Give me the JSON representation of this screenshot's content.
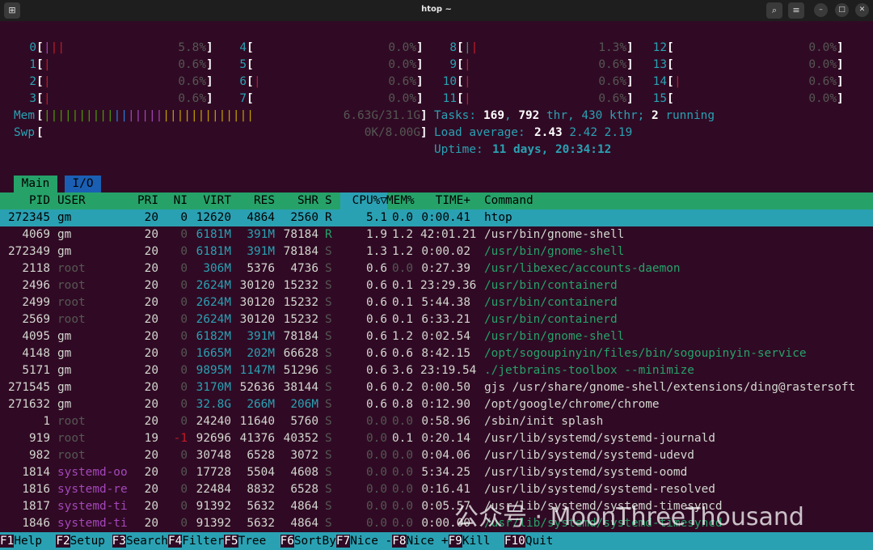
{
  "window": {
    "title": "htop ~"
  },
  "cpu_meters": [
    {
      "id": "0",
      "pct": "5.8%"
    },
    {
      "id": "1",
      "pct": "0.6%"
    },
    {
      "id": "2",
      "pct": "0.6%"
    },
    {
      "id": "3",
      "pct": "0.6%"
    },
    {
      "id": "4",
      "pct": "0.0%"
    },
    {
      "id": "5",
      "pct": "0.0%"
    },
    {
      "id": "6",
      "pct": "0.6%"
    },
    {
      "id": "7",
      "pct": "0.0%"
    },
    {
      "id": "8",
      "pct": "1.3%"
    },
    {
      "id": "9",
      "pct": "0.6%"
    },
    {
      "id": "10",
      "pct": "0.6%"
    },
    {
      "id": "11",
      "pct": "0.6%"
    },
    {
      "id": "12",
      "pct": "0.0%"
    },
    {
      "id": "13",
      "pct": "0.0%"
    },
    {
      "id": "14",
      "pct": "0.6%"
    },
    {
      "id": "15",
      "pct": "0.0%"
    }
  ],
  "mem": {
    "label": "Mem",
    "value": "6.63G/31.1G"
  },
  "swp": {
    "label": "Swp",
    "value": "0K/8.00G"
  },
  "tasks": {
    "label": "Tasks:",
    "tasks": "169",
    "thr": "792",
    "thr_label": "thr,",
    "kthr": "430",
    "kthr_label": "kthr;",
    "running": "2",
    "running_label": "running"
  },
  "load": {
    "label": "Load average:",
    "l1": "2.43",
    "l5": "2.42",
    "l15": "2.19"
  },
  "uptime": {
    "label": "Uptime:",
    "value": "11 days, 20:34:12"
  },
  "tabs": {
    "main": "Main",
    "io": "I/O"
  },
  "columns": {
    "pid": "PID",
    "user": "USER",
    "pri": "PRI",
    "ni": "NI",
    "virt": "VIRT",
    "res": "RES",
    "shr": "SHR",
    "s": "S",
    "cpu": "CPU%▽",
    "mem": "MEM%",
    "time": "TIME+",
    "command": "Command"
  },
  "processes": [
    {
      "pid": "272345",
      "user": "gm",
      "pri": "20",
      "ni": "0",
      "virt": "12620",
      "res": "4864",
      "shr": "2560",
      "s": "R",
      "cpu": "5.1",
      "mem": "0.0",
      "time": "0:00.41",
      "command": "htop"
    },
    {
      "pid": "4069",
      "user": "gm",
      "pri": "20",
      "ni": "0",
      "virt": "6181M",
      "res": "391M",
      "shr": "78184",
      "s": "R",
      "cpu": "1.9",
      "mem": "1.2",
      "time": "42:01.21",
      "command": "/usr/bin/gnome-shell"
    },
    {
      "pid": "272349",
      "user": "gm",
      "pri": "20",
      "ni": "0",
      "virt": "6181M",
      "res": "391M",
      "shr": "78184",
      "s": "S",
      "cpu": "1.3",
      "mem": "1.2",
      "time": "0:00.02",
      "command": "/usr/bin/gnome-shell"
    },
    {
      "pid": "2118",
      "user": "root",
      "pri": "20",
      "ni": "0",
      "virt": "306M",
      "res": "5376",
      "shr": "4736",
      "s": "S",
      "cpu": "0.6",
      "mem": "0.0",
      "time": "0:27.39",
      "command": "/usr/libexec/accounts-daemon"
    },
    {
      "pid": "2496",
      "user": "root",
      "pri": "20",
      "ni": "0",
      "virt": "2624M",
      "res": "30120",
      "shr": "15232",
      "s": "S",
      "cpu": "0.6",
      "mem": "0.1",
      "time": "23:29.36",
      "command": "/usr/bin/containerd"
    },
    {
      "pid": "2499",
      "user": "root",
      "pri": "20",
      "ni": "0",
      "virt": "2624M",
      "res": "30120",
      "shr": "15232",
      "s": "S",
      "cpu": "0.6",
      "mem": "0.1",
      "time": "5:44.38",
      "command": "/usr/bin/containerd"
    },
    {
      "pid": "2569",
      "user": "root",
      "pri": "20",
      "ni": "0",
      "virt": "2624M",
      "res": "30120",
      "shr": "15232",
      "s": "S",
      "cpu": "0.6",
      "mem": "0.1",
      "time": "6:33.21",
      "command": "/usr/bin/containerd"
    },
    {
      "pid": "4095",
      "user": "gm",
      "pri": "20",
      "ni": "0",
      "virt": "6182M",
      "res": "391M",
      "shr": "78184",
      "s": "S",
      "cpu": "0.6",
      "mem": "1.2",
      "time": "0:02.54",
      "command": "/usr/bin/gnome-shell"
    },
    {
      "pid": "4148",
      "user": "gm",
      "pri": "20",
      "ni": "0",
      "virt": "1665M",
      "res": "202M",
      "shr": "66628",
      "s": "S",
      "cpu": "0.6",
      "mem": "0.6",
      "time": "8:42.15",
      "command": "/opt/sogoupinyin/files/bin/sogoupinyin-service"
    },
    {
      "pid": "5171",
      "user": "gm",
      "pri": "20",
      "ni": "0",
      "virt": "9895M",
      "res": "1147M",
      "shr": "51296",
      "s": "S",
      "cpu": "0.6",
      "mem": "3.6",
      "time": "23:19.54",
      "command": "./jetbrains-toolbox --minimize"
    },
    {
      "pid": "271545",
      "user": "gm",
      "pri": "20",
      "ni": "0",
      "virt": "3170M",
      "res": "52636",
      "shr": "38144",
      "s": "S",
      "cpu": "0.6",
      "mem": "0.2",
      "time": "0:00.50",
      "command": "gjs /usr/share/gnome-shell/extensions/ding@rastersoft"
    },
    {
      "pid": "271632",
      "user": "gm",
      "pri": "20",
      "ni": "0",
      "virt": "32.8G",
      "res": "266M",
      "shr": "206M",
      "s": "S",
      "cpu": "0.6",
      "mem": "0.8",
      "time": "0:12.90",
      "command": "/opt/google/chrome/chrome"
    },
    {
      "pid": "1",
      "user": "root",
      "pri": "20",
      "ni": "0",
      "virt": "24240",
      "res": "11640",
      "shr": "5760",
      "s": "S",
      "cpu": "0.0",
      "mem": "0.0",
      "time": "0:58.96",
      "command": "/sbin/init splash"
    },
    {
      "pid": "919",
      "user": "root",
      "pri": "19",
      "ni": "-1",
      "virt": "92696",
      "res": "41376",
      "shr": "40352",
      "s": "S",
      "cpu": "0.0",
      "mem": "0.1",
      "time": "0:20.14",
      "command": "/usr/lib/systemd/systemd-journald"
    },
    {
      "pid": "982",
      "user": "root",
      "pri": "20",
      "ni": "0",
      "virt": "30748",
      "res": "6528",
      "shr": "3072",
      "s": "S",
      "cpu": "0.0",
      "mem": "0.0",
      "time": "0:04.06",
      "command": "/usr/lib/systemd/systemd-udevd"
    },
    {
      "pid": "1814",
      "user": "systemd-oo",
      "pri": "20",
      "ni": "0",
      "virt": "17728",
      "res": "5504",
      "shr": "4608",
      "s": "S",
      "cpu": "0.0",
      "mem": "0.0",
      "time": "5:34.25",
      "command": "/usr/lib/systemd/systemd-oomd"
    },
    {
      "pid": "1816",
      "user": "systemd-re",
      "pri": "20",
      "ni": "0",
      "virt": "22484",
      "res": "8832",
      "shr": "6528",
      "s": "S",
      "cpu": "0.0",
      "mem": "0.0",
      "time": "0:16.41",
      "command": "/usr/lib/systemd/systemd-resolved"
    },
    {
      "pid": "1817",
      "user": "systemd-ti",
      "pri": "20",
      "ni": "0",
      "virt": "91392",
      "res": "5632",
      "shr": "4864",
      "s": "S",
      "cpu": "0.0",
      "mem": "0.0",
      "time": "0:05.57",
      "command": "/usr/lib/systemd/systemd-timesyncd"
    },
    {
      "pid": "1846",
      "user": "systemd-ti",
      "pri": "20",
      "ni": "0",
      "virt": "91392",
      "res": "5632",
      "shr": "4864",
      "s": "S",
      "cpu": "0.0",
      "mem": "0.0",
      "time": "0:00.00",
      "command": "/usr/lib/systemd/systemd-timesyncd"
    }
  ],
  "fkeys": [
    {
      "key": "F1",
      "label": "Help  "
    },
    {
      "key": "F2",
      "label": "Setup "
    },
    {
      "key": "F3",
      "label": "Search"
    },
    {
      "key": "F4",
      "label": "Filter"
    },
    {
      "key": "F5",
      "label": "Tree  "
    },
    {
      "key": "F6",
      "label": "SortBy"
    },
    {
      "key": "F7",
      "label": "Nice -"
    },
    {
      "key": "F8",
      "label": "Nice +"
    },
    {
      "key": "F9",
      "label": "Kill  "
    },
    {
      "key": "F10",
      "label": "Quit"
    }
  ],
  "watermark": "公众号 · MoonThreeThousand",
  "colors": {
    "terminal_bg": "#300a24",
    "header_bg": "#26a269",
    "selected_bg": "#2aa1b3",
    "accent_cyan": "#2aa1b3"
  }
}
